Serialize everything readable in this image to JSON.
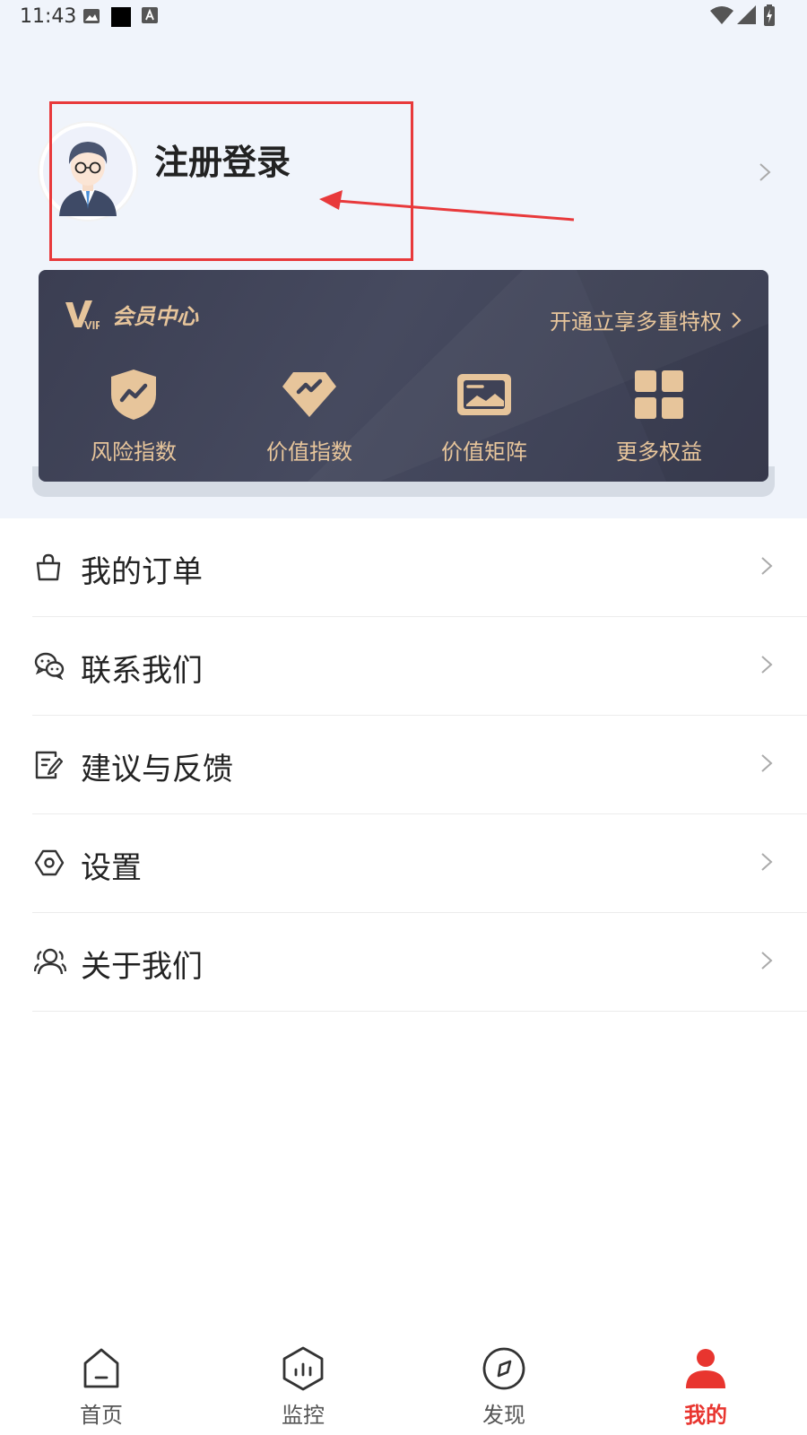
{
  "status_bar": {
    "time": "11:43"
  },
  "profile": {
    "title": "注册登录"
  },
  "vip": {
    "logo_text": "VIP",
    "title": "会员中心",
    "promo": "开通立享多重特权",
    "benefits": [
      {
        "label": "风险指数",
        "icon": "shield-chart-icon"
      },
      {
        "label": "价值指数",
        "icon": "diamond-chart-icon"
      },
      {
        "label": "价值矩阵",
        "icon": "image-card-icon"
      },
      {
        "label": "更多权益",
        "icon": "grid-icon"
      }
    ]
  },
  "menu": [
    {
      "label": "我的订单",
      "icon": "shopping-bag-icon"
    },
    {
      "label": "联系我们",
      "icon": "wechat-icon"
    },
    {
      "label": "建议与反馈",
      "icon": "feedback-icon"
    },
    {
      "label": "设置",
      "icon": "settings-icon"
    },
    {
      "label": "关于我们",
      "icon": "users-icon"
    }
  ],
  "tabs": [
    {
      "label": "首页",
      "icon": "home-icon"
    },
    {
      "label": "监控",
      "icon": "monitor-icon"
    },
    {
      "label": "发现",
      "icon": "compass-icon"
    },
    {
      "label": "我的",
      "icon": "user-icon",
      "active": true
    }
  ],
  "colors": {
    "accent": "#e8352f",
    "gold": "#e7c59b",
    "card": "#3f4256",
    "background": "#f0f4fb",
    "annotation": "#e8393b"
  }
}
